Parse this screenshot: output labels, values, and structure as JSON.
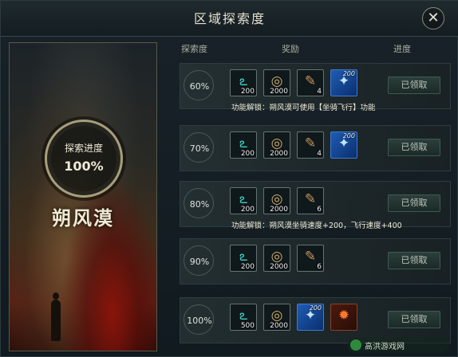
{
  "dialog": {
    "title": "区域探索度",
    "close_icon": "close-icon"
  },
  "zone": {
    "progress_label": "探索进度",
    "progress_value": "100%",
    "name": "朔风漠"
  },
  "table": {
    "headers": [
      "探索度",
      "奖励",
      "进度"
    ],
    "rows": [
      {
        "percent": "60%",
        "rewards": [
          {
            "icon": "teal-token-icon",
            "qty": "200",
            "top": ""
          },
          {
            "icon": "coin-icon",
            "qty": "2000",
            "top": ""
          },
          {
            "icon": "scroll-icon",
            "qty": "4",
            "top": ""
          },
          {
            "icon": "blue-crystal-icon",
            "qty": "",
            "top": "200"
          }
        ],
        "status": "已领取",
        "note": "功能解锁：朔风漠可使用【坐骑飞行】功能"
      },
      {
        "percent": "70%",
        "rewards": [
          {
            "icon": "teal-token-icon",
            "qty": "200",
            "top": ""
          },
          {
            "icon": "coin-icon",
            "qty": "2000",
            "top": ""
          },
          {
            "icon": "scroll-icon",
            "qty": "4",
            "top": ""
          },
          {
            "icon": "blue-crystal-icon",
            "qty": "",
            "top": "200"
          }
        ],
        "status": "已领取",
        "note": ""
      },
      {
        "percent": "80%",
        "rewards": [
          {
            "icon": "teal-token-icon",
            "qty": "200",
            "top": ""
          },
          {
            "icon": "coin-icon",
            "qty": "2000",
            "top": ""
          },
          {
            "icon": "scroll-icon",
            "qty": "6",
            "top": ""
          }
        ],
        "status": "已领取",
        "note": "功能解锁：朔风漠坐骑速度+200，飞行速度+400"
      },
      {
        "percent": "90%",
        "rewards": [
          {
            "icon": "teal-token-icon",
            "qty": "200",
            "top": ""
          },
          {
            "icon": "coin-icon",
            "qty": "2000",
            "top": ""
          },
          {
            "icon": "scroll-icon",
            "qty": "6",
            "top": ""
          }
        ],
        "status": "已领取",
        "note": ""
      },
      {
        "percent": "100%",
        "rewards": [
          {
            "icon": "teal-token-icon",
            "qty": "500",
            "top": ""
          },
          {
            "icon": "coin-icon",
            "qty": "2000",
            "top": ""
          },
          {
            "icon": "blue-crystal-icon",
            "qty": "",
            "top": "200"
          },
          {
            "icon": "ember-rune-icon",
            "qty": "",
            "top": ""
          }
        ],
        "status": "已领取",
        "note": ""
      }
    ]
  },
  "watermark": {
    "text": "高洪游戏网"
  }
}
